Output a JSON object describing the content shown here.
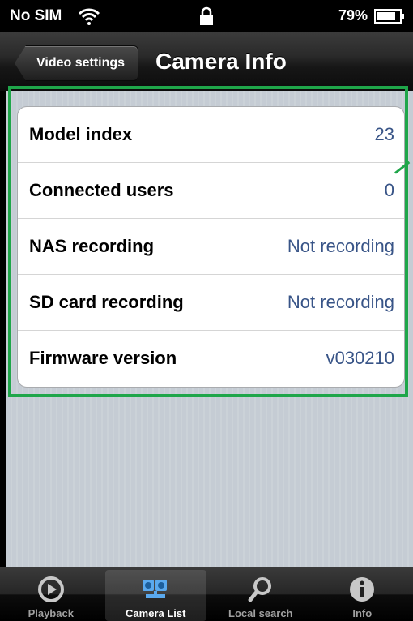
{
  "status_bar": {
    "carrier": "No SIM",
    "battery_percent": "79%",
    "icons": [
      "wifi-icon",
      "lock-icon",
      "battery-icon"
    ]
  },
  "nav": {
    "back_label": "Video settings",
    "title": "Camera Info"
  },
  "rows": [
    {
      "label": "Model index",
      "value": "23"
    },
    {
      "label": "Connected users",
      "value": "0"
    },
    {
      "label": "NAS recording",
      "value": "Not recording"
    },
    {
      "label": "SD card recording",
      "value": "Not recording"
    },
    {
      "label": "Firmware version",
      "value": "v030210"
    }
  ],
  "tabs": [
    {
      "label": "Playback",
      "icon": "playback-icon",
      "active": false
    },
    {
      "label": "Camera List",
      "icon": "camera-list-icon",
      "active": true
    },
    {
      "label": "Local search",
      "icon": "search-icon",
      "active": false
    },
    {
      "label": "Info",
      "icon": "info-icon",
      "active": false
    }
  ],
  "colors": {
    "value_text": "#385487",
    "highlight": "#1fa64a",
    "background": "#c5ccd4"
  }
}
